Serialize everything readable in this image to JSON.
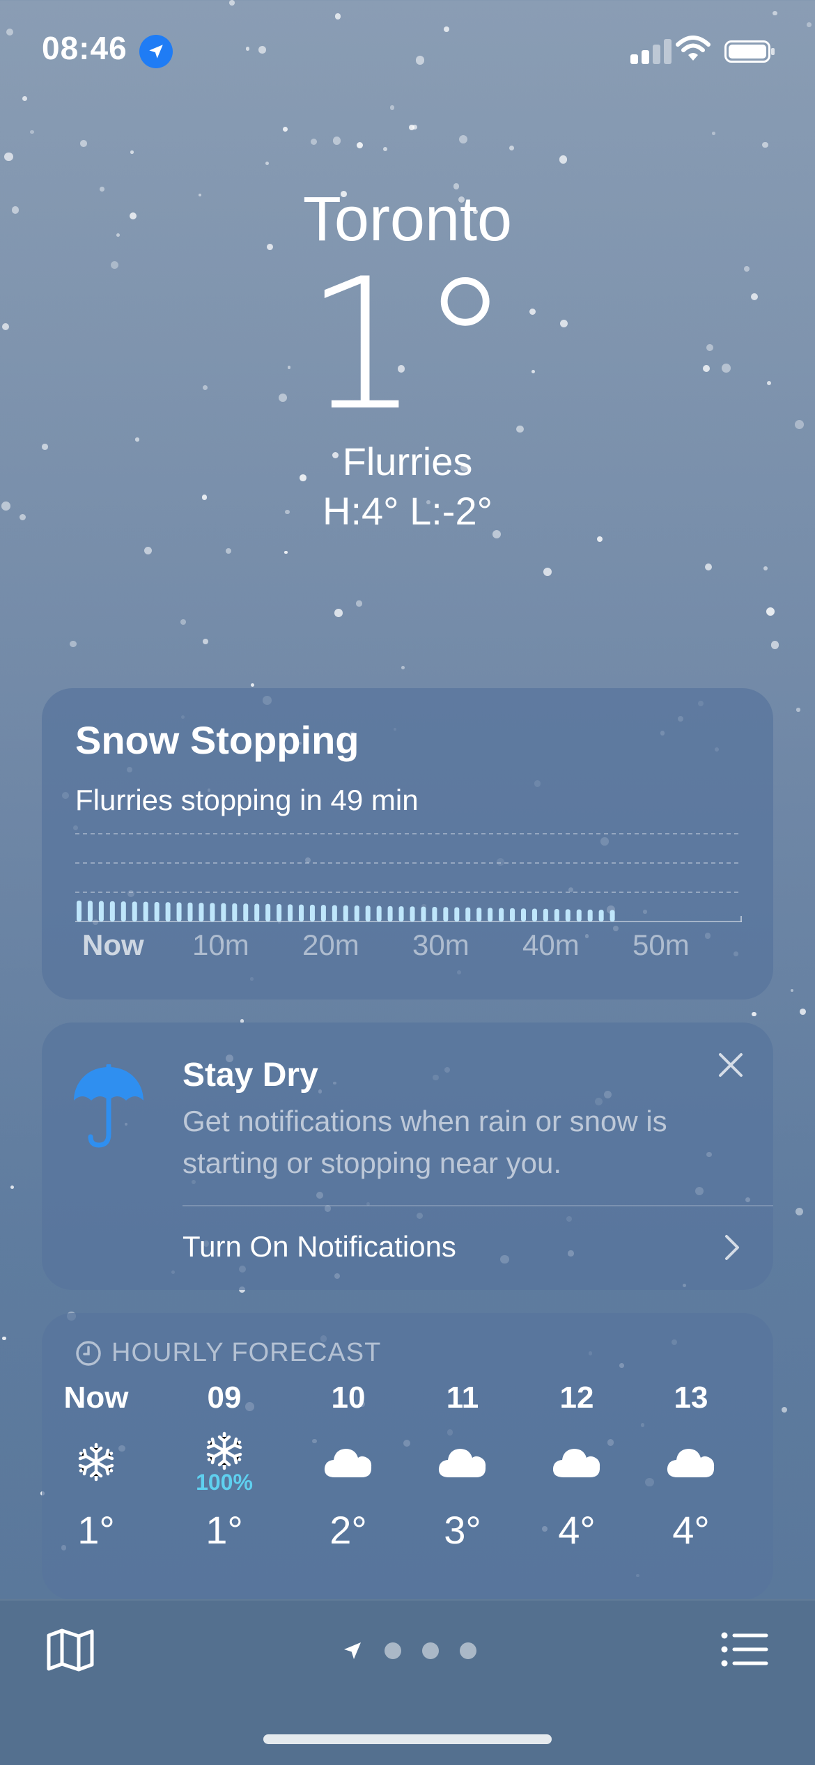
{
  "status_bar": {
    "time": "08:46"
  },
  "header": {
    "city": "Toronto",
    "temperature": "1°",
    "condition": "Flurries",
    "hi_lo": "H:4°  L:-2°"
  },
  "precip_card": {
    "title": "Snow Stopping",
    "subtitle": "Flurries stopping in 49 min",
    "time_labels": [
      "Now",
      "10m",
      "20m",
      "30m",
      "40m",
      "50m"
    ],
    "minutes_with_snow": 49,
    "total_minutes": 60,
    "bar_color": "#bfe6fb"
  },
  "notify_card": {
    "title": "Stay Dry",
    "body": "Get notifications when rain or snow is starting or stopping near you.",
    "link": "Turn On Notifications",
    "umbrella_color": "#2f8ff0"
  },
  "hourly": {
    "header": "HOURLY FORECAST",
    "items": [
      {
        "label": "Now",
        "icon": "snowflake-icon",
        "precip": "",
        "temp": "1°"
      },
      {
        "label": "09",
        "icon": "snowflake-icon",
        "precip": "100%",
        "temp": "1°"
      },
      {
        "label": "10",
        "icon": "cloud-icon",
        "precip": "",
        "temp": "2°"
      },
      {
        "label": "11",
        "icon": "cloud-icon",
        "precip": "",
        "temp": "3°"
      },
      {
        "label": "12",
        "icon": "cloud-icon",
        "precip": "",
        "temp": "4°"
      },
      {
        "label": "13",
        "icon": "cloud-icon",
        "precip": "",
        "temp": "4°"
      }
    ]
  },
  "bottom_bar": {
    "page_count": 3,
    "current_is_location": true
  }
}
